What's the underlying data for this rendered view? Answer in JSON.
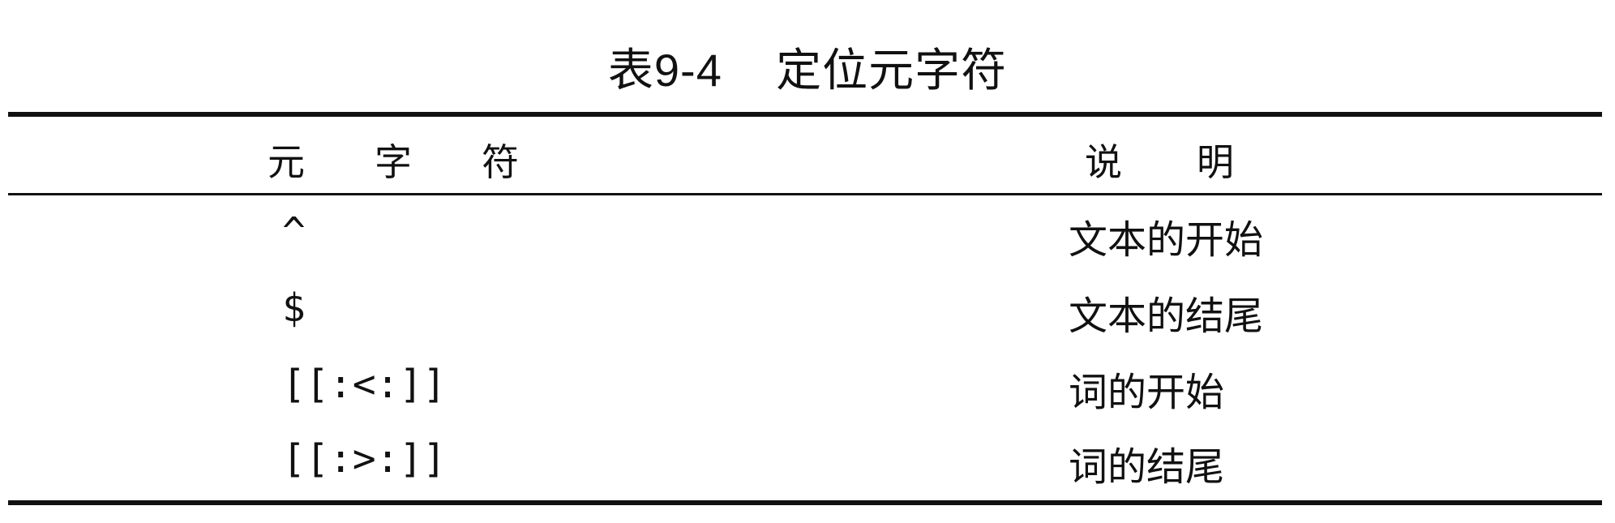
{
  "caption": "表9-4    定位元字符",
  "table": {
    "headers": [
      "元　字　符",
      "说　　明"
    ],
    "rows": [
      {
        "metachar": "^",
        "description": "文本的开始"
      },
      {
        "metachar": "$",
        "description": "文本的结尾"
      },
      {
        "metachar": "[[:<:]]",
        "description": "词的开始"
      },
      {
        "metachar": "[[:>:]]",
        "description": "词的结尾"
      }
    ]
  }
}
